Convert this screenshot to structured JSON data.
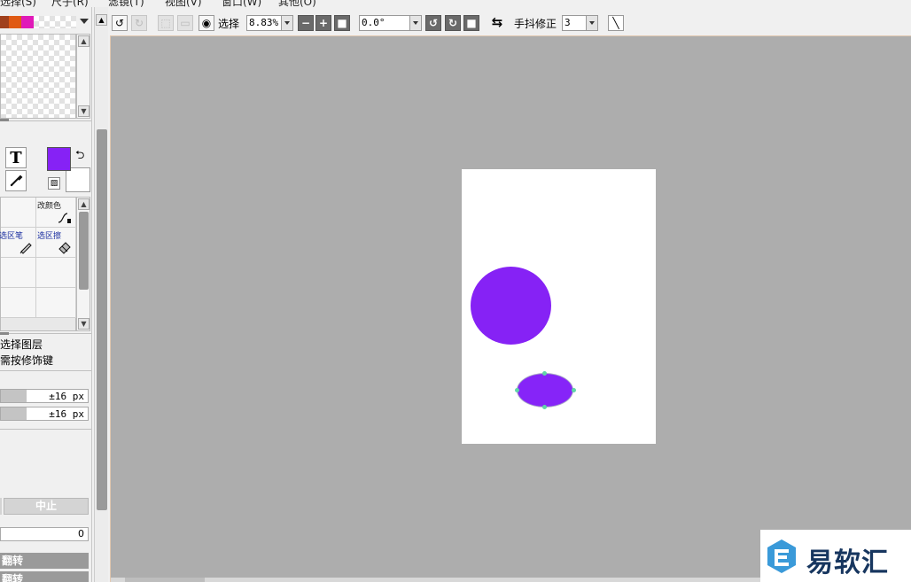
{
  "menu": {
    "items": [
      "选择(S)",
      "尺子(R)",
      "滤镜(T)",
      "视图(V)",
      "窗口(W)",
      "其他(O)"
    ]
  },
  "colors": {
    "accent": "#8622f5",
    "workspace": "#adadad",
    "swatches": [
      "#a0401c",
      "#e05a14",
      "#e01ab8"
    ]
  },
  "tools": {
    "text_tool": "T",
    "eyedropper": "eyedropper-icon"
  },
  "brushes": {
    "items": [
      {
        "label": "改颜色",
        "icon": "curve-icon"
      },
      {
        "label": "选区笔",
        "icon": "pen-icon"
      },
      {
        "label": "选区擦",
        "icon": "eraser-icon"
      }
    ]
  },
  "options": {
    "select_layer": "选择图层",
    "modifier_key": "需按修饰键"
  },
  "sliders": [
    {
      "value": "±16 px",
      "fraction": 0.3
    },
    {
      "value": "±16 px",
      "fraction": 0.3
    }
  ],
  "actions": {
    "stop": "中止",
    "number": "0",
    "flip_h": "翻转",
    "flip_v": "翻转"
  },
  "toolbar": {
    "select_label": "选择",
    "zoom": "8.83%",
    "rotation": "0.0°",
    "stabilizer_label": "手抖修正",
    "stabilizer_value": "3"
  },
  "watermark": {
    "text": "易软汇"
  }
}
